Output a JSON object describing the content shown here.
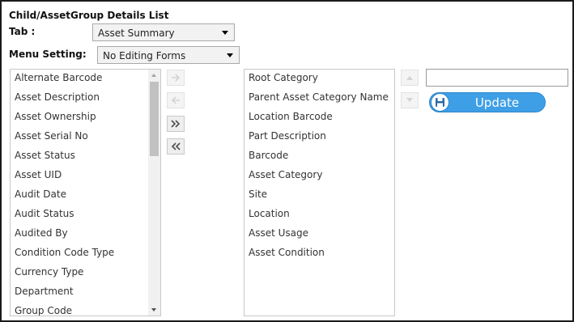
{
  "title": "Child/AssetGroup Details List",
  "tab": {
    "label": "Tab :",
    "selected": "Asset Summary"
  },
  "menu_setting": {
    "label": "Menu Setting:",
    "selected": "No Editing Forms"
  },
  "available_fields": [
    "Alternate Barcode",
    "Asset Description",
    "Asset Ownership",
    "Asset Serial No",
    "Asset Status",
    "Asset UID",
    "Audit Date",
    "Audit Status",
    "Audited By",
    "Condition Code Type",
    "Currency Type",
    "Department",
    "Group Code"
  ],
  "selected_fields": [
    "Root Category",
    "Parent Asset Category Name",
    "Location Barcode",
    "Part Description",
    "Barcode",
    "Asset Category",
    "Site",
    "Location",
    "Asset Usage",
    "Asset Condition"
  ],
  "update_button": {
    "label": "Update"
  },
  "colors": {
    "accent": "#3f9fe6",
    "border": "#1a1a1a"
  }
}
